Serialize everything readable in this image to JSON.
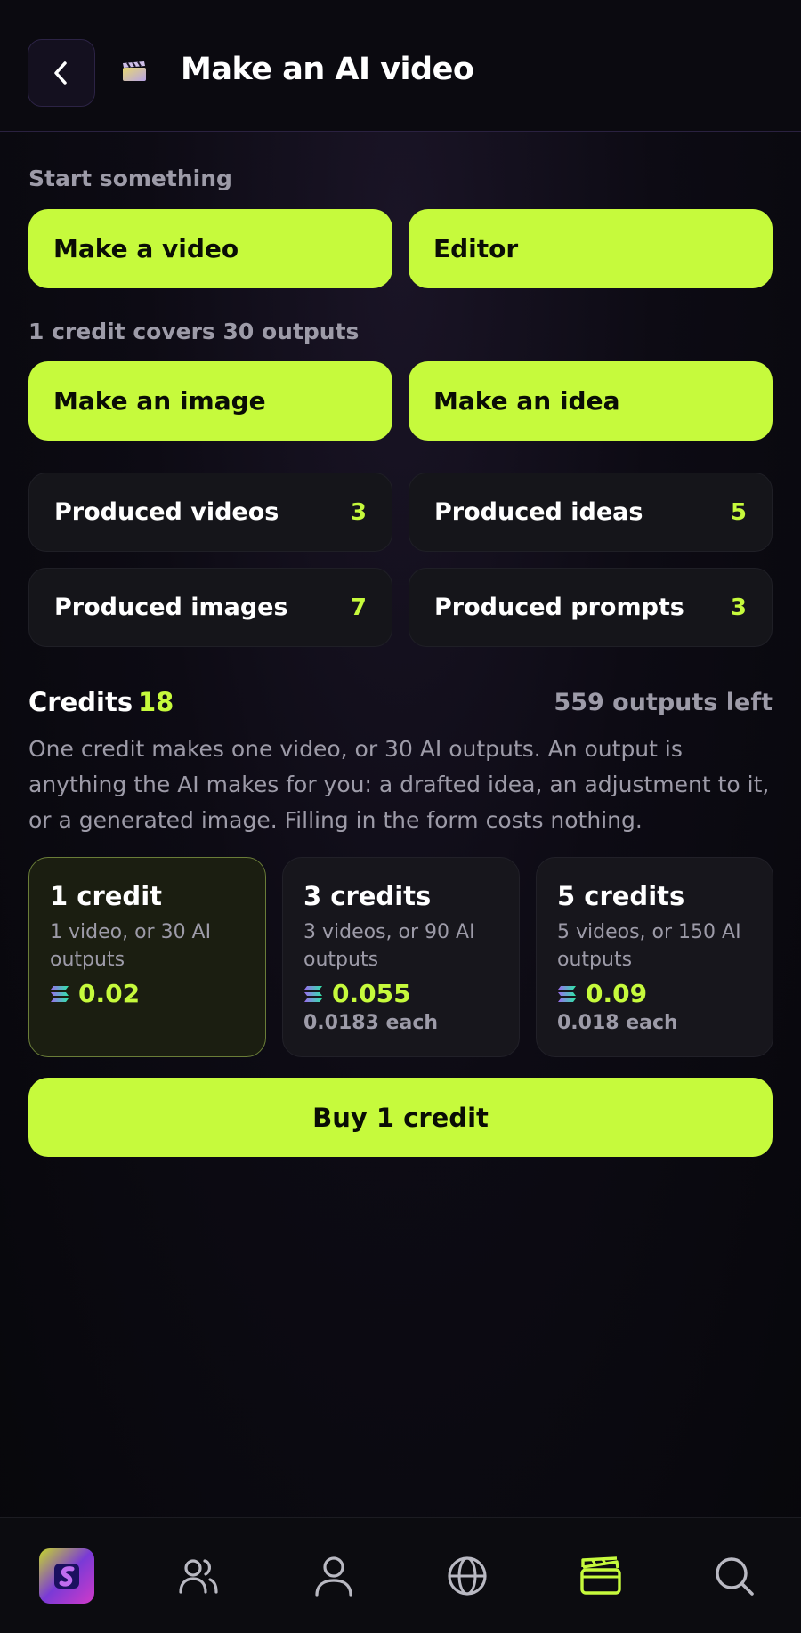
{
  "header": {
    "title": "Make an AI video"
  },
  "start": {
    "label": "Start something",
    "make_video": "Make a video",
    "editor": "Editor"
  },
  "outputs": {
    "label": "1 credit covers 30 outputs",
    "make_image": "Make an image",
    "make_idea": "Make an idea"
  },
  "stats": [
    {
      "label": "Produced videos",
      "value": "3"
    },
    {
      "label": "Produced ideas",
      "value": "5"
    },
    {
      "label": "Produced images",
      "value": "7"
    },
    {
      "label": "Produced prompts",
      "value": "3"
    }
  ],
  "credits": {
    "title": "Credits",
    "count": "18",
    "outputs_left": "559 outputs left",
    "description": "One credit makes one video, or 30 AI outputs. An output is anything the AI makes for you: a drafted idea, an adjustment to it, or a generated image. Filling in the form costs nothing."
  },
  "plans": [
    {
      "title": "1 credit",
      "sub": "1 video, or 30 AI outputs",
      "price": "0.02",
      "each": ""
    },
    {
      "title": "3 credits",
      "sub": "3 videos, or 90 AI outputs",
      "price": "0.055",
      "each": "0.0183 each"
    },
    {
      "title": "5 credits",
      "sub": "5 videos, or 150 AI outputs",
      "price": "0.09",
      "each": "0.018 each"
    }
  ],
  "buy_button": "Buy 1 credit",
  "colors": {
    "accent": "#c6fa3c",
    "muted": "#9d9ba8",
    "background": "#0b0a10"
  },
  "nav": [
    "app-logo-icon",
    "people-icon",
    "person-icon",
    "globe-icon",
    "clapperboard-icon",
    "search-icon"
  ]
}
